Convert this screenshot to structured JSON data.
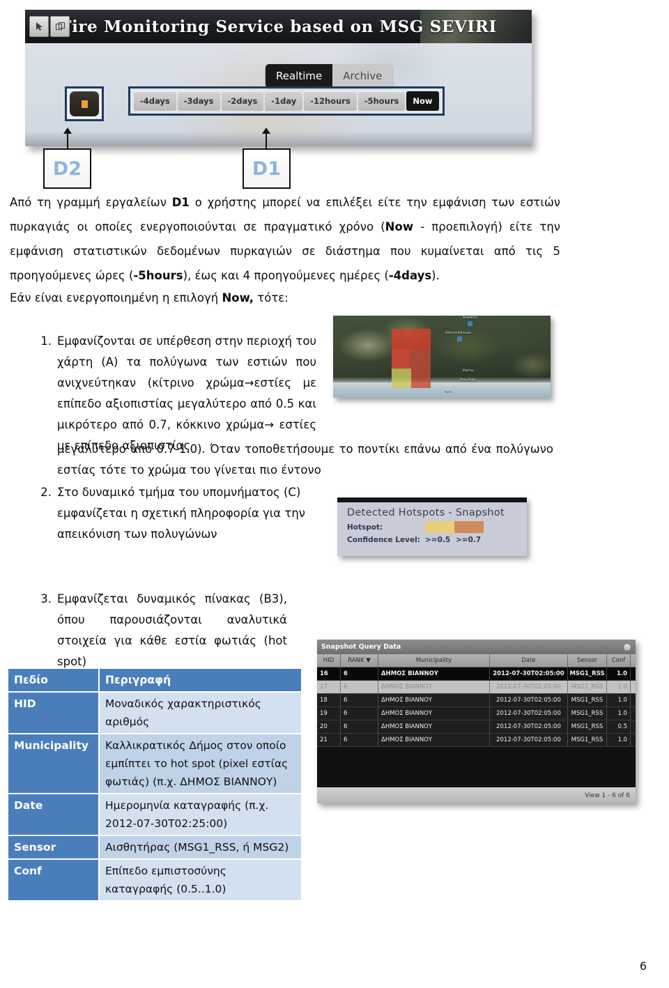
{
  "figure_top": {
    "app_title": "Fire Monitoring Service based on MSG SEVIRI",
    "window_buttons": [
      {
        "name": "pointer-tool",
        "glyph": "pointer"
      },
      {
        "name": "restore-window",
        "glyph": "restore"
      }
    ],
    "mode_tabs": [
      {
        "label": "Realtime",
        "active": true
      },
      {
        "label": "Archive",
        "active": false
      }
    ],
    "time_segments": [
      {
        "label": "-4days",
        "active": false
      },
      {
        "label": "-3days",
        "active": false
      },
      {
        "label": "-2days",
        "active": false
      },
      {
        "label": "-1day",
        "active": false
      },
      {
        "label": "-12hours",
        "active": false
      },
      {
        "label": "-5hours",
        "active": false
      },
      {
        "label": "Now",
        "active": true
      }
    ],
    "callouts": [
      {
        "label": "D2"
      },
      {
        "label": "D1"
      }
    ],
    "callout_color": "#8eb4df",
    "highlight_box_color": "#1f3a5f"
  },
  "body": {
    "paragraph_1_parts": [
      {
        "t": "Από τη γραμμή εργαλείων ",
        "b": false
      },
      {
        "t": "D1",
        "b": true
      },
      {
        "t": " ο χρήστης μπορεί να επιλέξει είτε την εμφάνιση των εστιών πυρκαγιάς οι οποίες ενεργοποιούνται σε πραγματικό χρόνο (",
        "b": false
      },
      {
        "t": "Now",
        "b": true
      },
      {
        "t": " - προεπιλογή) είτε την εμφάνιση στατιστικών δεδομένων πυρκαγιών σε διάστημα που κυμαίνεται από τις 5 προηγούμενες ώρες (",
        "b": false
      },
      {
        "t": "-5hours",
        "b": true
      },
      {
        "t": "), έως και 4 προηγούμενες ημέρες (",
        "b": false
      },
      {
        "t": "-4days",
        "b": true
      },
      {
        "t": ").",
        "b": false
      }
    ],
    "paragraph_2_parts": [
      {
        "t": "Εάν είναι ενεργοποιημένη η επιλογή ",
        "b": false
      },
      {
        "t": "Now,",
        "b": true
      },
      {
        "t": " τότε:",
        "b": false
      }
    ],
    "item_1_number": "1.",
    "item_1_narrow": "Εμφανίζονται σε υπέρθεση στην περιοχή του χάρτη (Α) τα πολύγωνα των εστιών που ανιχνεύτηκαν (κίτρινο χρώμα→εστίες με επίπεδο αξιοπιστίας μεγαλύτερο από 0.5 και μικρότερο από 0.7, κόκκινο χρώμα→ εστίες με επίπεδο αξιοπιστίας",
    "item_1_wide": "μεγαλύτερο από 0.7-1.0). Όταν τοποθετήσουμε το ποντίκι επάνω από ένα πολύγωνο εστίας τότε το χρώμα του γίνεται πιο έντονο",
    "item_2_number": "2.",
    "item_2_text": "Στο δυναμικό τμήμα του υπομνήματος (C) εμφανίζεται η σχετική πληροφορία για την απεικόνιση των πολυγώνων",
    "item_3_number": "3.",
    "item_3_text": "Εμφανίζεται δυναμικός πίνακας (B3), όπου παρουσιάζονται αναλυτικά στοιχεία για κάθε εστία φωτιάς (hot spot)"
  },
  "legend_figure": {
    "title": "Detected Hotspots - Snapshot",
    "row_hotspot_label": "Hotspot:",
    "row_confidence_label": "Confidence Level:",
    "swatch_low_color": "#e8cf7c",
    "swatch_high_color": "#d08a5c",
    "confidence_values": [
      ">=0.5",
      ">=0.7"
    ]
  },
  "map_figure": {
    "place_labels": [
      "Διασπίτη",
      "Αλεκτά Κάτωνα",
      "Κάστω",
      "Άνω Σύμη",
      "Αμπί"
    ]
  },
  "query_table": {
    "panel_title": "Snapshot Query Data",
    "gear_icon": "gear-icon",
    "columns": [
      "HID",
      "RANK ▼",
      "Municipality",
      "Date",
      "Sensor",
      "Conf"
    ],
    "rows": [
      {
        "hid": "16",
        "rank": "6",
        "municipality": "ΔΗΜΟΣ ΒΙΑΝΝΟΥ",
        "date": "2012-07-30T02:05:00",
        "sensor": "MSG1_RSS",
        "conf": "1.0",
        "state": "first"
      },
      {
        "hid": "17",
        "rank": "6",
        "municipality": "ΔΗΜΟΣ ΒΙΑΝΝΟΥ",
        "date": "2012-07-30T02:05:00",
        "sensor": "MSG1_RSS",
        "conf": "1.0",
        "state": "selected"
      },
      {
        "hid": "18",
        "rank": "6",
        "municipality": "ΔΗΜΟΣ ΒΙΑΝΝΟΥ",
        "date": "2012-07-30T02:05:00",
        "sensor": "MSG1_RSS",
        "conf": "1.0",
        "state": "normal"
      },
      {
        "hid": "19",
        "rank": "6",
        "municipality": "ΔΗΜΟΣ ΒΙΑΝΝΟΥ",
        "date": "2012-07-30T02:05:00",
        "sensor": "MSG1_RSS",
        "conf": "1.0",
        "state": "normal"
      },
      {
        "hid": "20",
        "rank": "6",
        "municipality": "ΔΗΜΟΣ ΒΙΑΝΝΟΥ",
        "date": "2012-07-30T02:05:00",
        "sensor": "MSG1_RSS",
        "conf": "0.5",
        "state": "normal"
      },
      {
        "hid": "21",
        "rank": "6",
        "municipality": "ΔΗΜΟΣ ΒΙΑΝΝΟΥ",
        "date": "2012-07-30T02:05:00",
        "sensor": "MSG1_RSS",
        "conf": "1.0",
        "state": "normal"
      }
    ],
    "footer": "View 1 - 6 of 6"
  },
  "definition_table": {
    "header": {
      "field": "Πεδίο",
      "description": "Περιγραφή"
    },
    "rows": [
      {
        "field": "HID",
        "description": "Μοναδικός χαρακτηριστικός αριθμός"
      },
      {
        "field": "Municipality",
        "description": "Καλλικρατικός Δήμος στον οποίο εμπίπτει το hot spot (pixel εστίας φωτιάς) (π.χ. ΔΗΜΟΣ ΒΙΑΝΝΟΥ)"
      },
      {
        "field": "Date",
        "description": "Ημερομηνία καταγραφής (π.χ. 2012-07-30T02:25:00)"
      },
      {
        "field": "Sensor",
        "description": "Αισθητήρας (MSG1_RSS, ή MSG2)"
      },
      {
        "field": "Conf",
        "description": "Επίπεδο εμπιστοσύνης καταγραφής (0.5..1.0)"
      }
    ]
  },
  "page_number": "6"
}
